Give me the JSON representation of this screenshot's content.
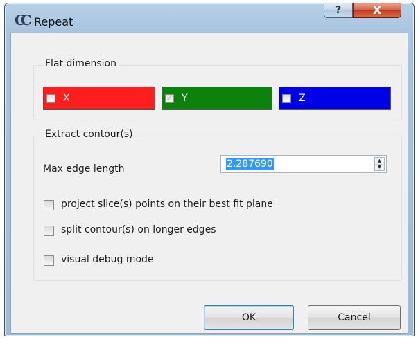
{
  "window": {
    "title": "Repeat",
    "app_icon_glyph": "CC",
    "help_glyph": "?",
    "close_glyph": "X"
  },
  "flat_dimension": {
    "title": "Flat dimension",
    "axes": [
      {
        "label": "X",
        "checked": false,
        "color": "#ff1e1e"
      },
      {
        "label": "Y",
        "checked": true,
        "color": "#0c820c"
      },
      {
        "label": "Z",
        "checked": false,
        "color": "#0000e6"
      }
    ],
    "check_glyph": "✓"
  },
  "extract": {
    "title": "Extract contour(s)",
    "max_edge_label": "Max edge length",
    "max_edge_value": "2.287690",
    "options": [
      {
        "label": "project slice(s) points on their best fit plane",
        "checked": false
      },
      {
        "label": "split contour(s) on longer edges",
        "checked": false
      },
      {
        "label": "visual debug mode",
        "checked": false
      }
    ]
  },
  "buttons": {
    "ok": "OK",
    "cancel": "Cancel"
  },
  "spin_glyphs": {
    "up": "▲",
    "down": "▼"
  }
}
